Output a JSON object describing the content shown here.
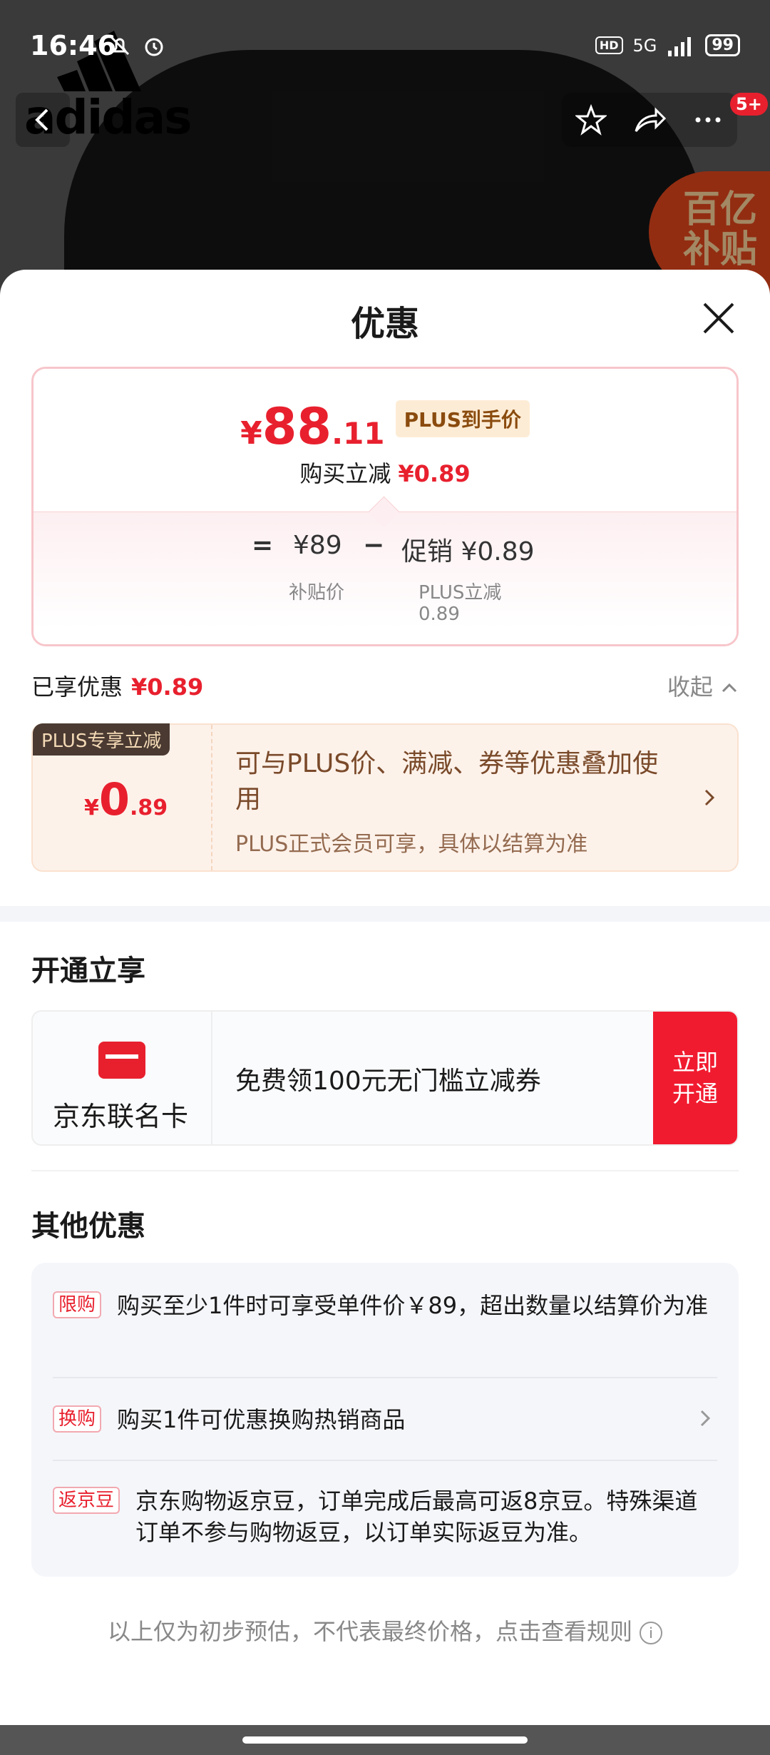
{
  "status_bar": {
    "time": "16:46",
    "network": "5G",
    "hd": "HD",
    "battery": "99"
  },
  "background": {
    "brand": "adidas",
    "subsidy_badge_line1": "百亿",
    "subsidy_badge_line2": "补贴",
    "message_badge": "5+"
  },
  "sheet": {
    "title": "优惠",
    "price": {
      "currency": "¥",
      "integer": "88",
      "decimal": ".11",
      "tag": "PLUS到手价",
      "instant_discount_label": "购买立减",
      "instant_discount_value": "¥0.89"
    },
    "formula": {
      "equals": "=",
      "base_price": "¥89",
      "minus": "−",
      "promo": "促销 ¥0.89",
      "base_label": "补贴价",
      "promo_label": "PLUS立减",
      "promo_sublabel": "0.89"
    },
    "enjoyed": {
      "label": "已享优惠",
      "value": "¥0.89",
      "collapse": "收起"
    },
    "plus_card": {
      "tag": "PLUS专享立减",
      "currency": "¥",
      "integer": "0",
      "decimal": ".89",
      "description": "可与PLUS价、满减、券等优惠叠加使用",
      "note": "PLUS正式会员可享，具体以结算为准"
    },
    "open_section": {
      "title": "开通立享",
      "card_name": "京东联名卡",
      "offer": "免费领100元无门槛立减券",
      "cta": "立即开通"
    },
    "other_section": {
      "title": "其他优惠",
      "items": [
        {
          "tag": "限购",
          "text": "购买至少1件时可享受单件价￥89，超出数量以结算价为准"
        },
        {
          "tag": "换购",
          "text": "购买1件可优惠换购热销商品"
        },
        {
          "tag": "返京豆",
          "text": "京东购物返京豆，订单完成后最高可返8京豆。特殊渠道订单不参与购物返豆，以订单实际返豆为准。"
        }
      ]
    },
    "footer": "以上仅为初步预估，不代表最终价格，点击查看规则"
  },
  "colors": {
    "accent_red": "#e8202e",
    "plus_gold": "#7a4a2a"
  }
}
